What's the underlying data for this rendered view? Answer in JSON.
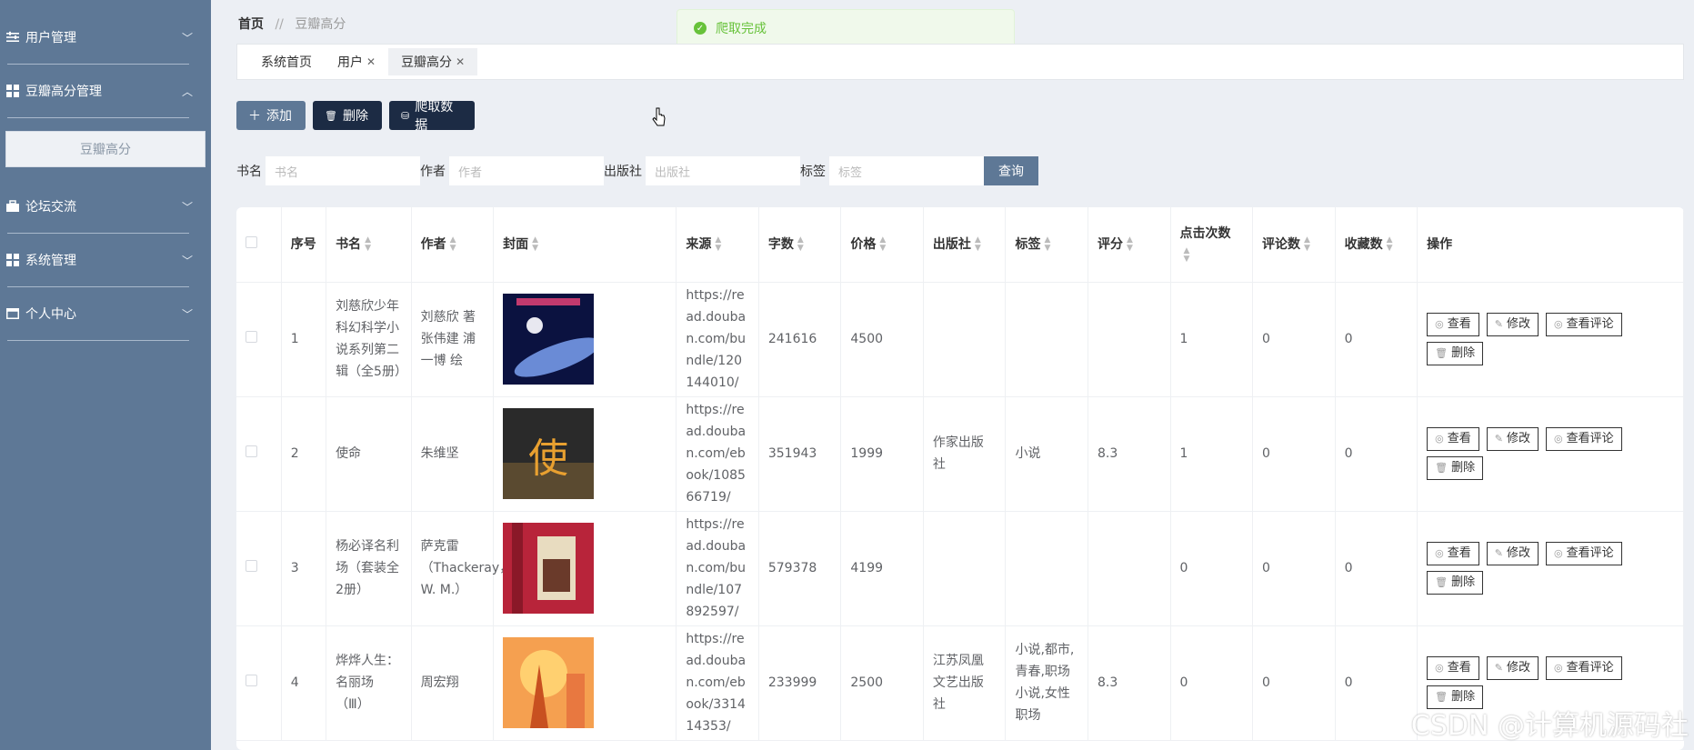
{
  "sidebar": {
    "groups": [
      {
        "label": "用户管理",
        "icon": "sliders-icon",
        "expanded": false
      },
      {
        "label": "豆瓣高分管理",
        "icon": "grid-icon",
        "expanded": true,
        "items": [
          "豆瓣高分"
        ]
      },
      {
        "label": "论坛交流",
        "icon": "briefcase-icon",
        "expanded": false
      },
      {
        "label": "系统管理",
        "icon": "grid-icon",
        "expanded": false
      },
      {
        "label": "个人中心",
        "icon": "window-icon",
        "expanded": false
      }
    ]
  },
  "breadcrumb": {
    "home": "首页",
    "separator": "//",
    "current": "豆瓣高分"
  },
  "toast": {
    "message": "爬取完成"
  },
  "tabs": [
    {
      "label": "系统首页",
      "closable": false
    },
    {
      "label": "用户",
      "closable": true
    },
    {
      "label": "豆瓣高分",
      "closable": true,
      "active": true
    }
  ],
  "toolbar": {
    "add": "添加",
    "delete": "删除",
    "crawl": "爬取数据"
  },
  "search": {
    "fields": [
      {
        "label": "书名",
        "placeholder": "书名"
      },
      {
        "label": "作者",
        "placeholder": "作者"
      },
      {
        "label": "出版社",
        "placeholder": "出版社"
      },
      {
        "label": "标签",
        "placeholder": "标签"
      }
    ],
    "query": "查询"
  },
  "table": {
    "headers": [
      "序号",
      "书名",
      "作者",
      "封面",
      "来源",
      "字数",
      "价格",
      "出版社",
      "标签",
      "评分",
      "点击次数",
      "评论数",
      "收藏数",
      "操作"
    ],
    "rows": [
      {
        "no": "1",
        "title": "刘慈欣少年科幻科学小说系列第二辑（全5册）",
        "author": "刘慈欣 著 张伟建 浦一博 绘",
        "source": "https://read.douban.com/bundle/120144010/",
        "words": "241616",
        "price": "4500",
        "publisher": "",
        "tags": "",
        "rating": "",
        "clicks": "1",
        "comments": "0",
        "favorites": "0",
        "cover": "cover-space"
      },
      {
        "no": "2",
        "title": "使命",
        "author": "朱维坚",
        "source": "https://read.douban.com/ebook/108566719/",
        "words": "351943",
        "price": "1999",
        "publisher": "作家出版社",
        "tags": "小说",
        "rating": "8.3",
        "clicks": "1",
        "comments": "0",
        "favorites": "0",
        "cover": "cover-mission"
      },
      {
        "no": "3",
        "title": "杨必译名利场（套装全2册）",
        "author": "萨克雷（Thackeray，W. M.）",
        "source": "https://read.douban.com/bundle/107892597/",
        "words": "579378",
        "price": "4199",
        "publisher": "",
        "tags": "",
        "rating": "",
        "clicks": "0",
        "comments": "0",
        "favorites": "0",
        "cover": "cover-vanity"
      },
      {
        "no": "4",
        "title": "烨烨人生：名丽场（Ⅲ）",
        "author": "周宏翔",
        "source": "https://read.douban.com/ebook/331414353/",
        "words": "233999",
        "price": "2500",
        "publisher": "江苏凤凰文艺出版社",
        "tags": "小说,都市,青春,职场小说,女性职场",
        "rating": "8.3",
        "clicks": "0",
        "comments": "0",
        "favorites": "0",
        "cover": "cover-life"
      }
    ],
    "ops": {
      "view": "查看",
      "edit": "修改",
      "reviews": "查看评论",
      "delete": "删除"
    }
  },
  "watermark": "CSDN @计算机源码社",
  "colors": {
    "sidebar": "#5e7896",
    "dark_button": "#1c2b44",
    "success": "#67c23a"
  }
}
